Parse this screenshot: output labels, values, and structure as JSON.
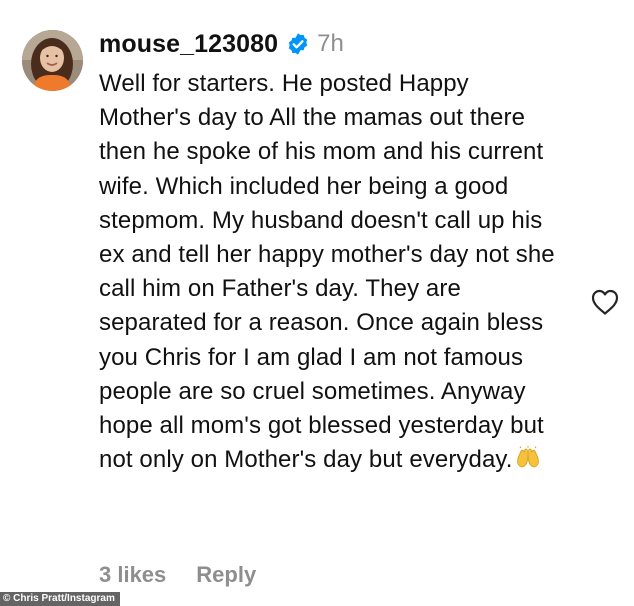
{
  "comment": {
    "username": "mouse_123080",
    "verified": true,
    "timestamp": "7h",
    "text": "Well for starters. He posted Happy Mother's day to All the mamas out there then he spoke of his mom and his current wife. Which included her being a good stepmom. My husband doesn't call up his ex and tell her happy mother's day not she call him on Father's day. They are separated for a reason. Once again bless you Chris for I am glad I am not famous people are so cruel sometimes. Anyway hope all mom's got blessed yesterday but not only on Mother's day but everyday.",
    "emoji": "raising-hands-emoji",
    "likes_label": "3 likes",
    "reply_label": "Reply",
    "like_icon": "heart-outline-icon",
    "verified_color": "#0095f6"
  },
  "credit": "© Chris Pratt/Instagram"
}
